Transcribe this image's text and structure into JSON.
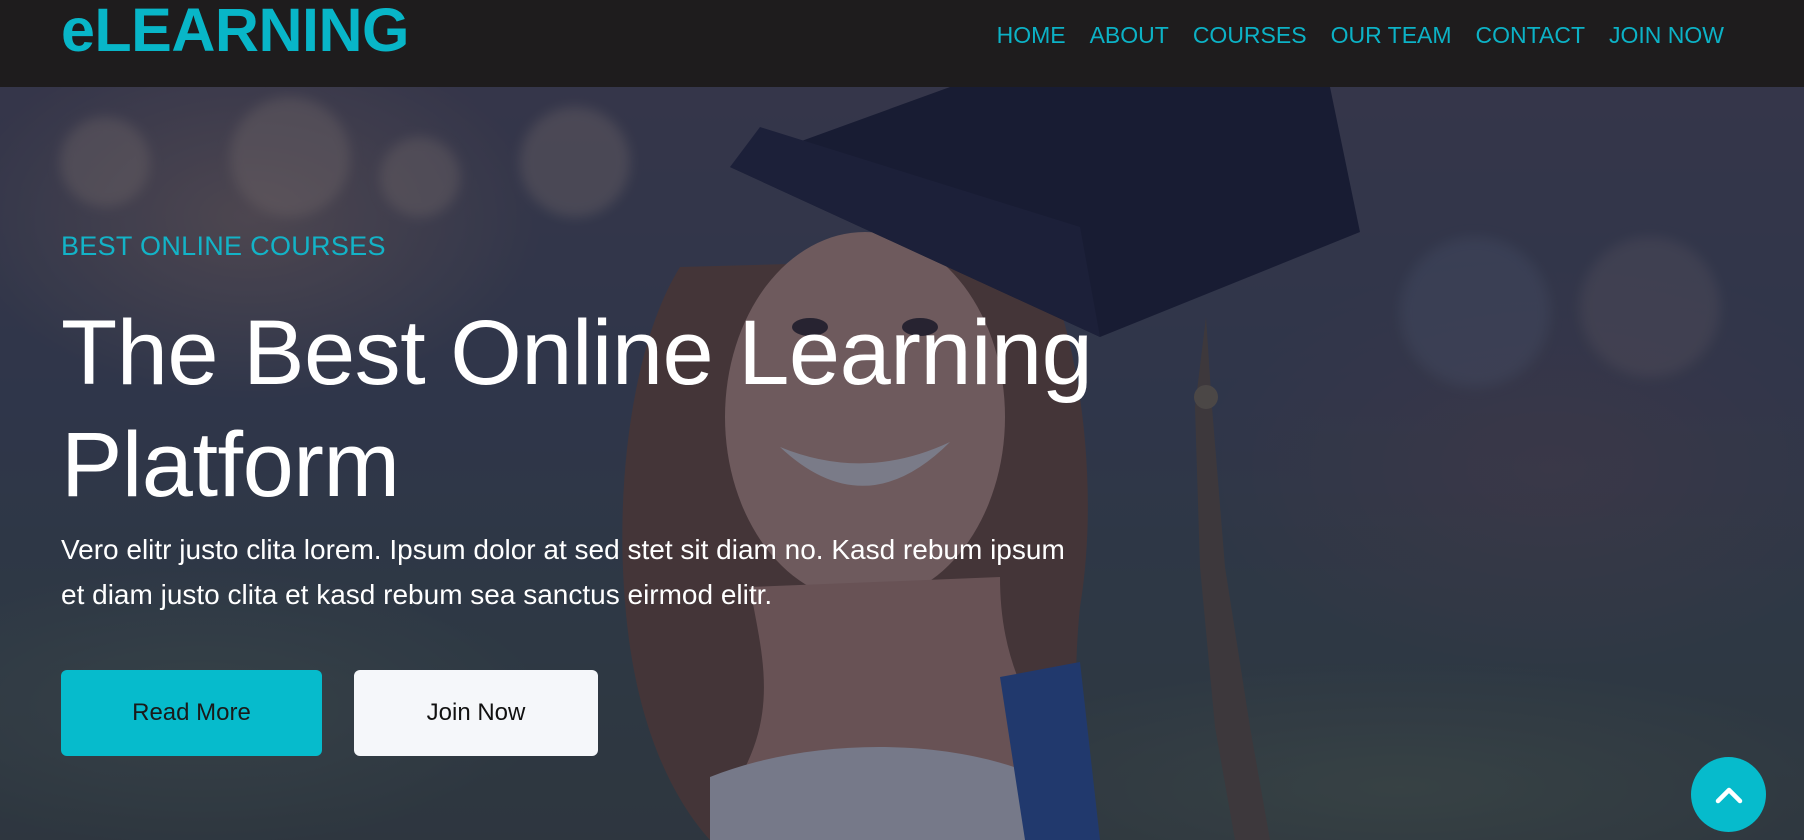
{
  "brand": {
    "logo_text": "eLEARNING"
  },
  "nav": {
    "items": [
      {
        "label": "HOME"
      },
      {
        "label": "ABOUT"
      },
      {
        "label": "COURSES"
      },
      {
        "label": "OUR TEAM"
      },
      {
        "label": "CONTACT"
      },
      {
        "label": "JOIN NOW"
      }
    ]
  },
  "hero": {
    "eyebrow": "BEST ONLINE COURSES",
    "headline_line1": "The Best Online Learning",
    "headline_line2": "Platform",
    "subtext_line1": "Vero elitr justo clita lorem. Ipsum dolor at sed stet sit diam no. Kasd rebum ipsum",
    "subtext_line2": "et diam justo clita et kasd rebum sea sanctus eirmod elitr.",
    "primary_button": "Read More",
    "secondary_button": "Join Now"
  },
  "icons": {
    "back_to_top": "chevron-up-icon"
  },
  "colors": {
    "accent": "#06bbcc",
    "navbar_bg": "#1e1c1d",
    "hero_overlay": "#181d38",
    "light_button": "#f5f7fa"
  }
}
